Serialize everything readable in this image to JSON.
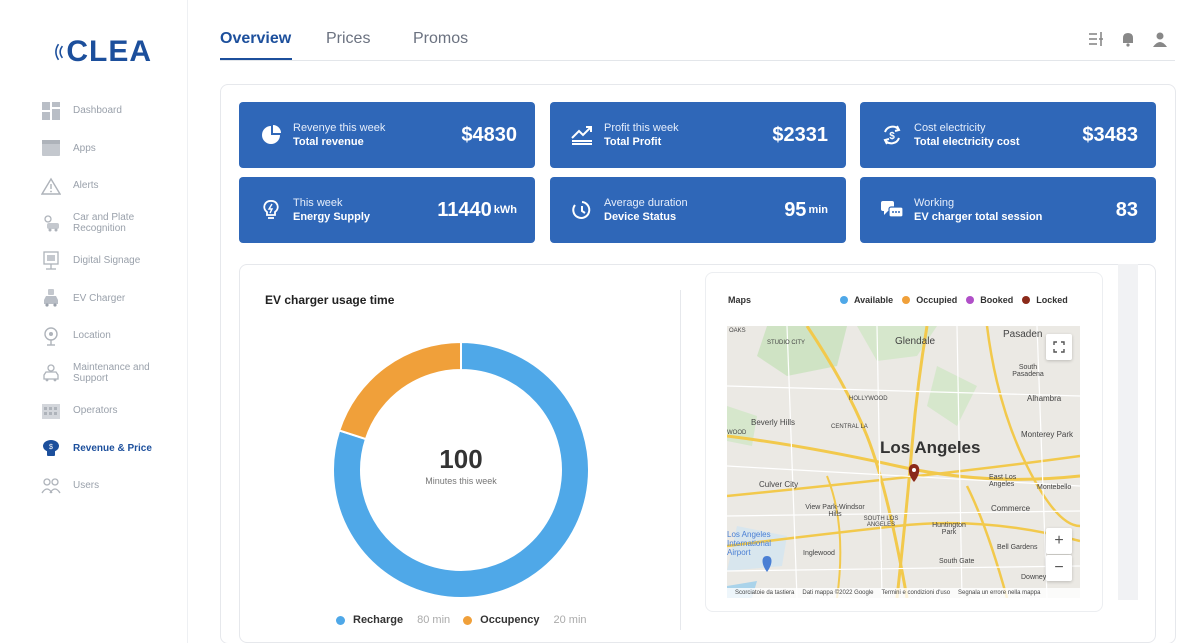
{
  "brand": {
    "logo_text": "CLEA"
  },
  "sidebar": {
    "items": [
      {
        "label": "Dashboard",
        "icon": "dashboard-icon"
      },
      {
        "label": "Apps",
        "icon": "apps-icon"
      },
      {
        "label": "Alerts",
        "icon": "alert-icon"
      },
      {
        "label": "Car and Plate\nRecognition",
        "label_1": "Car and Plate",
        "label_2": "Recognition",
        "icon": "car-recognition-icon"
      },
      {
        "label": "Digital Signage",
        "icon": "signage-icon"
      },
      {
        "label": "EV Charger",
        "icon": "ev-charger-icon"
      },
      {
        "label": "Location",
        "icon": "location-icon"
      },
      {
        "label_1": "Maintenance and",
        "label_2": "Support",
        "icon": "maintenance-icon"
      },
      {
        "label": "Operators",
        "icon": "operators-icon"
      },
      {
        "label": "Revenue & Price",
        "icon": "revenue-icon",
        "active": true
      },
      {
        "label": "Users",
        "icon": "users-icon"
      }
    ]
  },
  "tabs": [
    {
      "label": "Overview",
      "active": true
    },
    {
      "label": "Prices"
    },
    {
      "label": "Promos"
    }
  ],
  "cards": [
    {
      "sub": "Revenye this week",
      "title": "Total revenue",
      "value": "$4830",
      "unit": "",
      "icon": "pie-chart-icon"
    },
    {
      "sub": "Profit this week",
      "title": "Total Profit",
      "value": "$2331",
      "unit": "",
      "icon": "trend-up-icon"
    },
    {
      "sub": "Cost electricity",
      "title": "Total electricity cost",
      "value": "$3483",
      "unit": "",
      "icon": "cycle-dollar-icon"
    },
    {
      "sub": "This week",
      "title": "Energy Supply",
      "value": "11440",
      "unit": "kWh",
      "icon": "lightbulb-icon"
    },
    {
      "sub": "Average duration",
      "title": "Device Status",
      "value": "95",
      "unit": "min",
      "icon": "clock-icon"
    },
    {
      "sub": "Working",
      "title": "EV charger total session",
      "value": "83",
      "unit": "",
      "icon": "chat-session-icon"
    }
  ],
  "usage": {
    "title": "EV charger usage time",
    "center_value": "100",
    "center_label": "Minutes this week",
    "legend": [
      {
        "label": "Recharge",
        "value": "80 min",
        "minutes": 80,
        "color": "#4fa8e8"
      },
      {
        "label": "Occupency",
        "value": "20 min",
        "minutes": 20,
        "color": "#f0a03a"
      }
    ]
  },
  "map": {
    "label": "Maps",
    "legend": [
      {
        "label": "Available",
        "color": "#4fa8e8"
      },
      {
        "label": "Occupied",
        "color": "#f0a03a"
      },
      {
        "label": "Booked",
        "color": "#b04fc8"
      },
      {
        "label": "Locked",
        "color": "#8b2a1a"
      }
    ],
    "city": "Los Angeles",
    "places": [
      "Glendale",
      "Pasaden",
      "South Pasadena",
      "Alhambra",
      "Monterey Park",
      "Beverly Hills",
      "CENTRAL LA",
      "HOLLYWOOD",
      "STUDIO CITY",
      "Culver City",
      "View Park-Windsor Hills",
      "SOUTH LOS ANGELES",
      "East Los Angeles",
      "Montebello",
      "Commerce",
      "Huntington Park",
      "Los Angeles International Airport",
      "Inglewood",
      "South Gate",
      "Bell Gardens",
      "Downey",
      "WOOD",
      "OAKS"
    ],
    "footer": [
      "Scorciatoie da tastiera",
      "Dati mappa ©2022 Google",
      "Termini e condizioni d'uso",
      "Segnala un errore nella mappa"
    ],
    "zoom_in": "+",
    "zoom_out": "−"
  }
}
